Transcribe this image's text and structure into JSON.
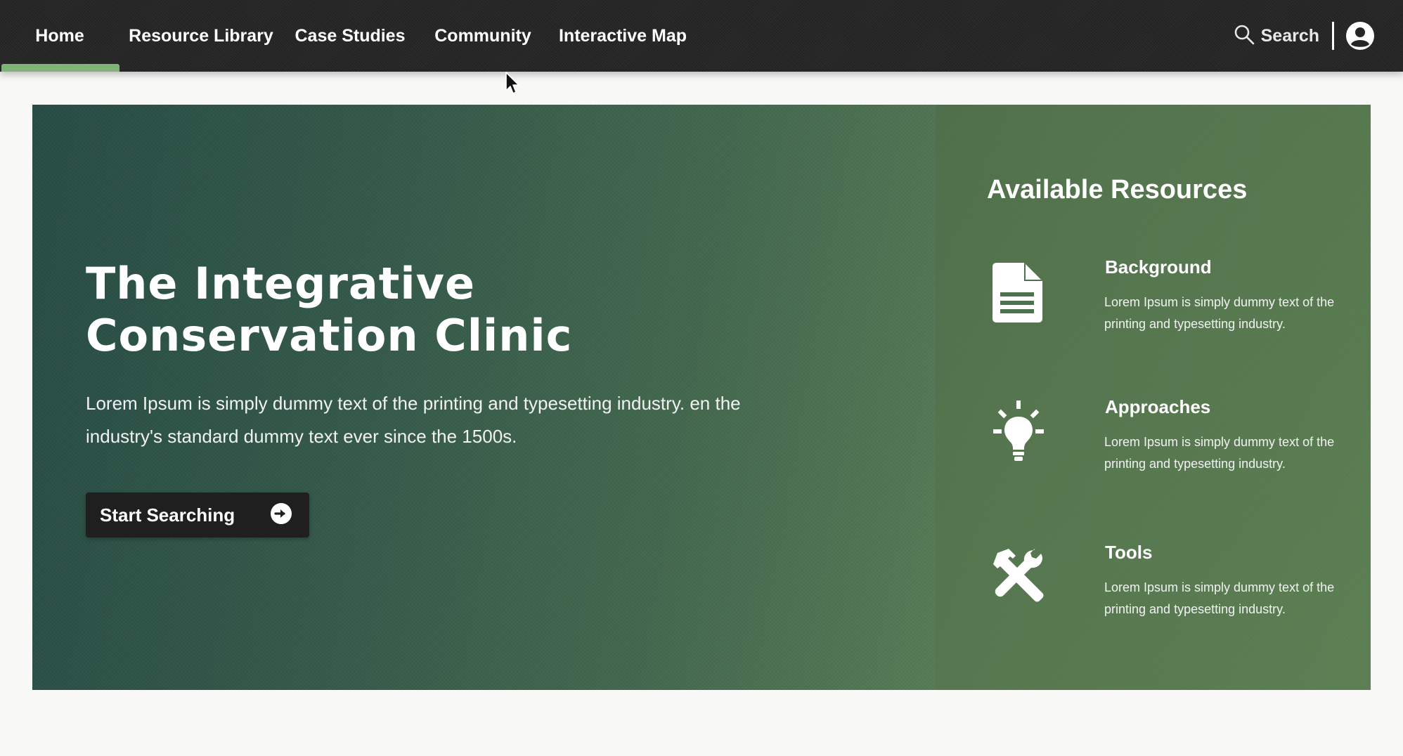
{
  "nav": {
    "items": [
      {
        "label": "Home",
        "active": true
      },
      {
        "label": "Resource Library"
      },
      {
        "label": "Case Studies"
      },
      {
        "label": "Community"
      },
      {
        "label": "Interactive Map"
      }
    ],
    "search_label": "Search",
    "active_indicator_color": "#7fb377"
  },
  "hero": {
    "title_line1": "The Integrative",
    "title_line2": "Conservation Clinic",
    "description": "Lorem Ipsum is simply dummy text of the printing and typesetting industry. en the industry's standard dummy text ever since the 1500s.",
    "cta_label": "Start Searching"
  },
  "resources": {
    "title": "Available Resources",
    "items": [
      {
        "title": "Background",
        "description": "Lorem Ipsum is simply dummy text of the printing and typesetting industry.",
        "icon": "document-icon"
      },
      {
        "title": "Approaches",
        "description": "Lorem Ipsum is simply dummy text of the printing and typesetting industry.",
        "icon": "lightbulb-icon"
      },
      {
        "title": "Tools",
        "description": "Lorem Ipsum is simply dummy text of the printing and typesetting industry.",
        "icon": "tools-icon"
      }
    ]
  },
  "colors": {
    "navbar_bg": "#262626",
    "hero_gradient_start": "#284d45",
    "hero_gradient_end": "#64885b",
    "cta_bg": "#1f1f1f"
  }
}
